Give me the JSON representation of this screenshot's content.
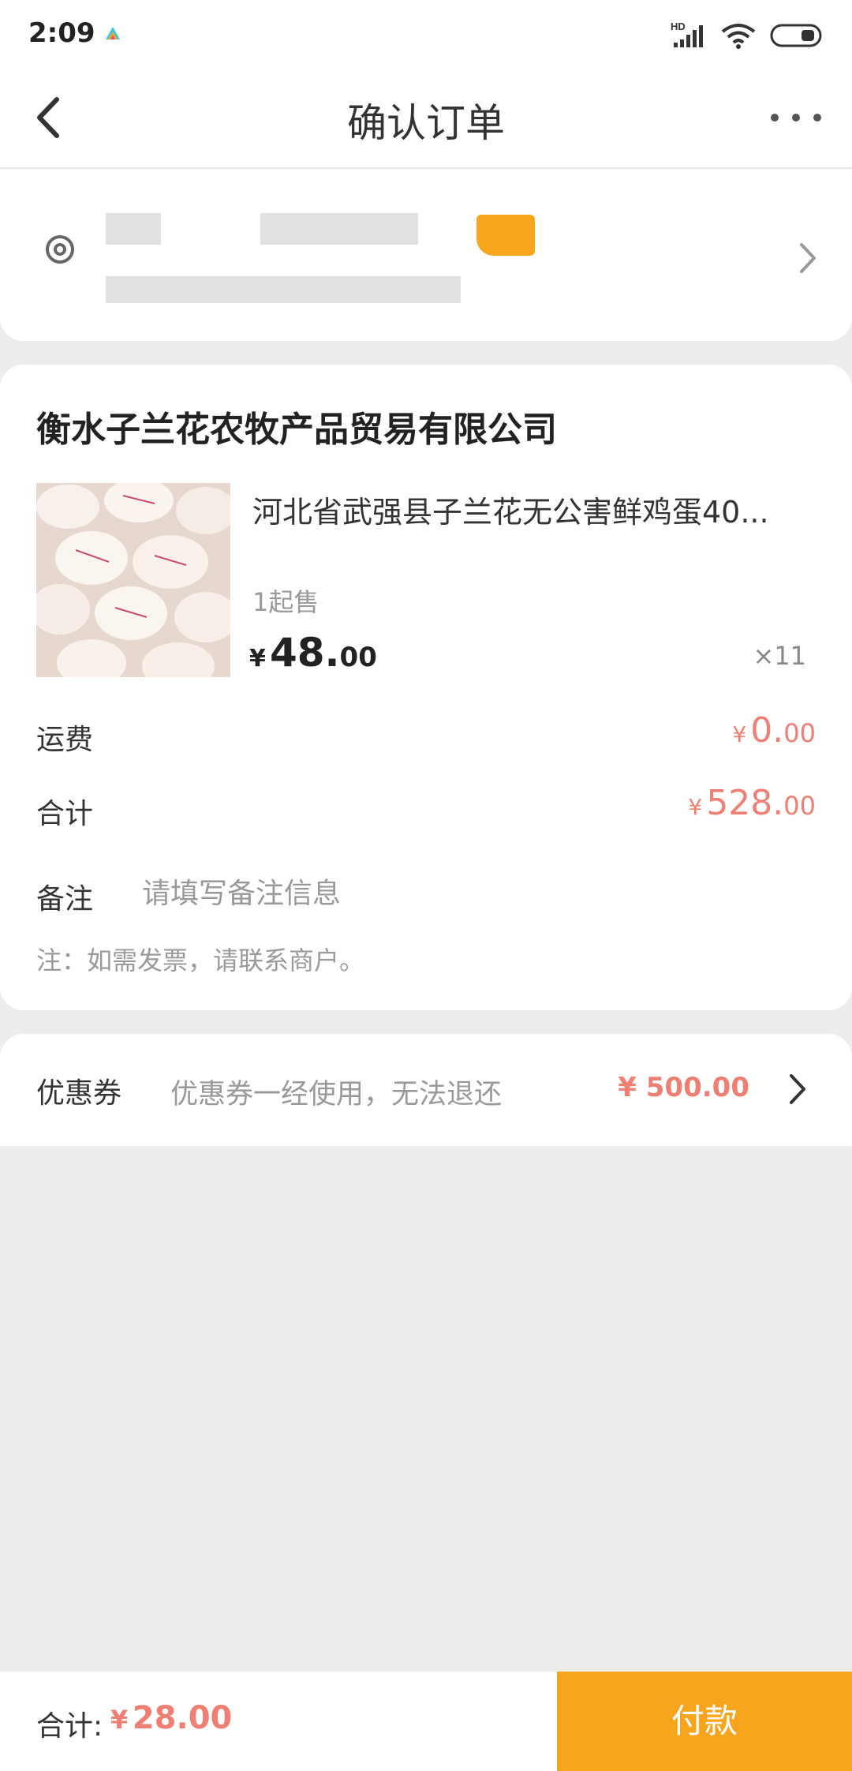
{
  "status_bar": {
    "time": "2:09",
    "hd_label": "HD",
    "icons": [
      "app-indicator-icon",
      "signal-icon",
      "wifi-icon",
      "battery-icon"
    ]
  },
  "nav": {
    "title": "确认订单",
    "back_icon": "chevron-left-icon",
    "more_icon": "more-dots-icon"
  },
  "address": {
    "name": "",
    "phone": "",
    "badge": "",
    "detail": "",
    "redacted": true,
    "icon": "location-pin-icon"
  },
  "order": {
    "shop_name": "衡水子兰花农牧产品贸易有限公司",
    "product": {
      "title": "河北省武强县子兰花无公害鲜鸡蛋40...",
      "min_order": "1起售",
      "price_currency": "¥",
      "price_int": "48.",
      "price_dec": "00",
      "quantity": "×11",
      "image": "egg-product-image"
    },
    "shipping": {
      "label": "运费",
      "currency": "¥",
      "int": "0.",
      "dec": "00"
    },
    "subtotal": {
      "label": "合计",
      "currency": "¥",
      "int": "528.",
      "dec": "00"
    },
    "remark": {
      "label": "备注",
      "value": "",
      "placeholder": "请填写备注信息"
    },
    "invoice_note": "注：如需发票，请联系商户。"
  },
  "coupon": {
    "label": "优惠券",
    "description": "优惠券一经使用，无法退还",
    "amount": "¥ 500.00"
  },
  "footer": {
    "total_label": "合计:",
    "currency": "¥",
    "amount": "28.00",
    "pay_label": "付款"
  },
  "colors": {
    "accent_orange": "#f7a51c",
    "price_red": "#ef7f72",
    "background": "#ededed"
  }
}
